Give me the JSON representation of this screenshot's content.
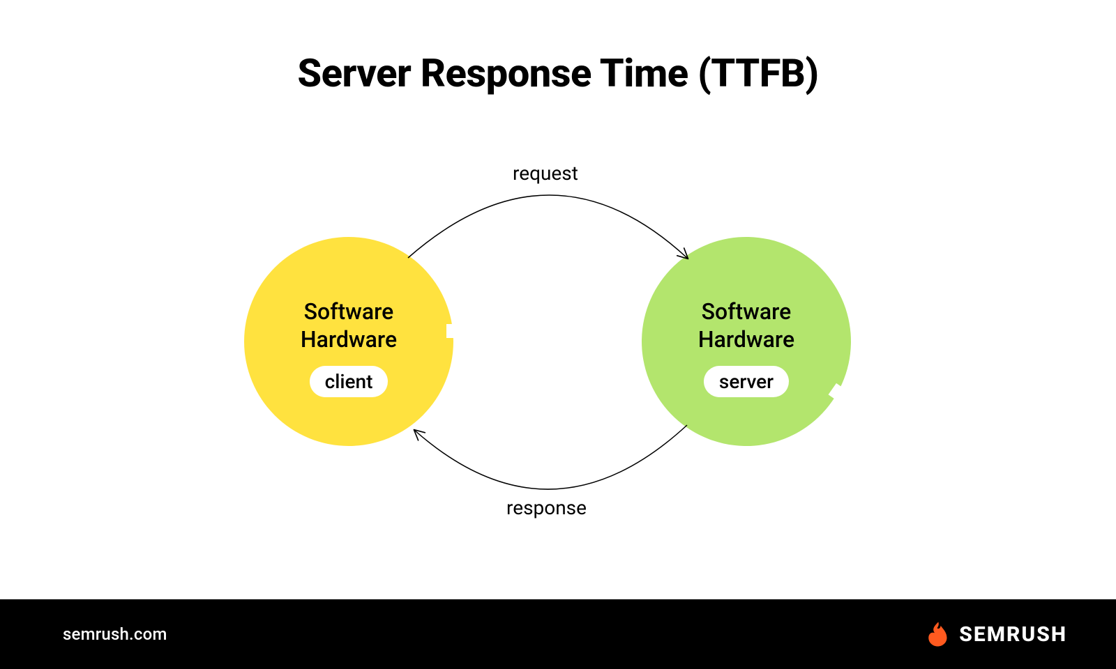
{
  "title": "Server Response Time (TTFB)",
  "nodes": {
    "client": {
      "line1": "Software",
      "line2": "Hardware",
      "pill": "client",
      "color": "#ffe23f"
    },
    "server": {
      "line1": "Software",
      "line2": "Hardware",
      "pill": "server",
      "color": "#b3e56d"
    }
  },
  "edges": {
    "request": "request",
    "response": "response"
  },
  "footer": {
    "site": "semrush.com",
    "brand": "SEMRUSH",
    "brandColor": "#ff5a1f"
  }
}
